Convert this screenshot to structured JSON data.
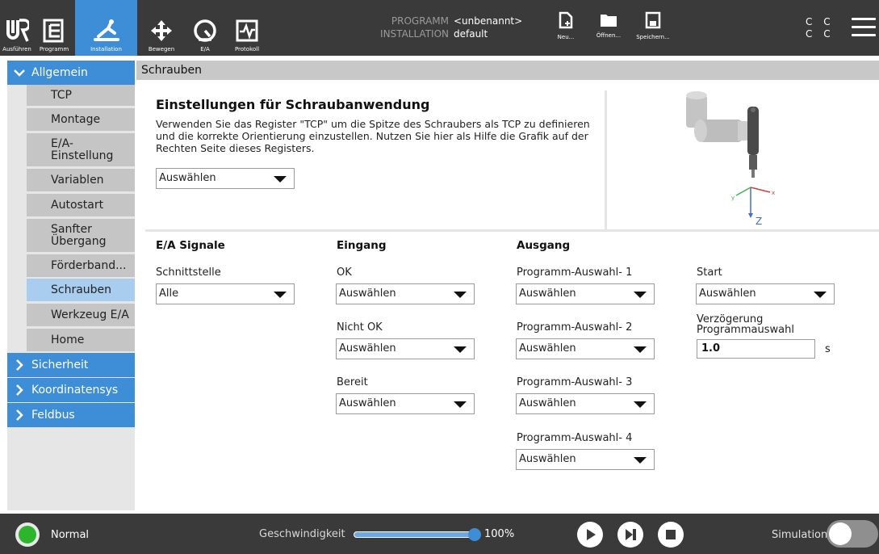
{
  "topbar": {
    "nav": [
      {
        "label": "Ausführen"
      },
      {
        "label": "Programm"
      },
      {
        "label": "Installation"
      },
      {
        "label": "Bewegen"
      },
      {
        "label": "E/A"
      },
      {
        "label": "Protokoll"
      }
    ],
    "program_key": "PROGRAMM",
    "program_value": "<unbenannt>",
    "installation_key": "INSTALLATION",
    "installation_value": "default",
    "file_buttons": [
      {
        "label": "Neu..."
      },
      {
        "label": "Öffnen..."
      },
      {
        "label": "Speichern..."
      }
    ],
    "cc_row1": "C C",
    "cc_row2": "C C"
  },
  "sidebar": {
    "section_general": "Allgemein",
    "items": [
      {
        "label": "TCP"
      },
      {
        "label": "Montage"
      },
      {
        "label": "E/A-\nEinstellung"
      },
      {
        "label": "Variablen"
      },
      {
        "label": "Autostart"
      },
      {
        "label": "Sanfter\nÜbergang"
      },
      {
        "label": "Förderband..."
      },
      {
        "label": "Schrauben"
      },
      {
        "label": "Werkzeug E/A"
      },
      {
        "label": "Home"
      }
    ],
    "sections": [
      {
        "label": "Sicherheit"
      },
      {
        "label": "Koordinatensys"
      },
      {
        "label": "Feldbus"
      }
    ]
  },
  "main": {
    "header": "Schrauben",
    "title": "Einstellungen für Schraubanwendung",
    "description": "Verwenden Sie das Register \"TCP\" um die Spitze des Schraubers als TCP zu definieren und die korrekte Orientierung einzustellen. Nutzen Sie hier als Hilfe die Grafik auf der Rechten Seite dieses Registers.",
    "tool_select": "Auswählen",
    "axis_x": "x",
    "axis_y": "y",
    "axis_z": "Z",
    "columns": {
      "signals": "E/A Signale",
      "input": "Eingang",
      "output": "Ausgang"
    },
    "interface_label": "Schnittstelle",
    "interface_value": "Alle",
    "inputs": [
      {
        "label": "OK",
        "value": "Auswählen"
      },
      {
        "label": "Nicht OK",
        "value": "Auswählen"
      },
      {
        "label": "Bereit",
        "value": "Auswählen"
      }
    ],
    "outputs": [
      {
        "label": "Programm-Auswahl- 1",
        "value": "Auswählen"
      },
      {
        "label": "Programm-Auswahl- 2",
        "value": "Auswählen"
      },
      {
        "label": "Programm-Auswahl- 3",
        "value": "Auswählen"
      },
      {
        "label": "Programm-Auswahl- 4",
        "value": "Auswählen"
      }
    ],
    "start_label": "Start",
    "start_value": "Auswählen",
    "delay_label": "Verzögerung\nProgrammauswahl",
    "delay_value": "1.0",
    "delay_unit": "s"
  },
  "bottombar": {
    "status": "Normal",
    "speed_label": "Geschwindigkeit",
    "speed_value": "100%",
    "speed_fraction": 1.0,
    "simulation_label": "Simulation"
  },
  "colors": {
    "accent": "#3e8ed7",
    "bar": "#3a3a3a",
    "selected": "#a8cdee",
    "status_ok": "#2db52d"
  }
}
